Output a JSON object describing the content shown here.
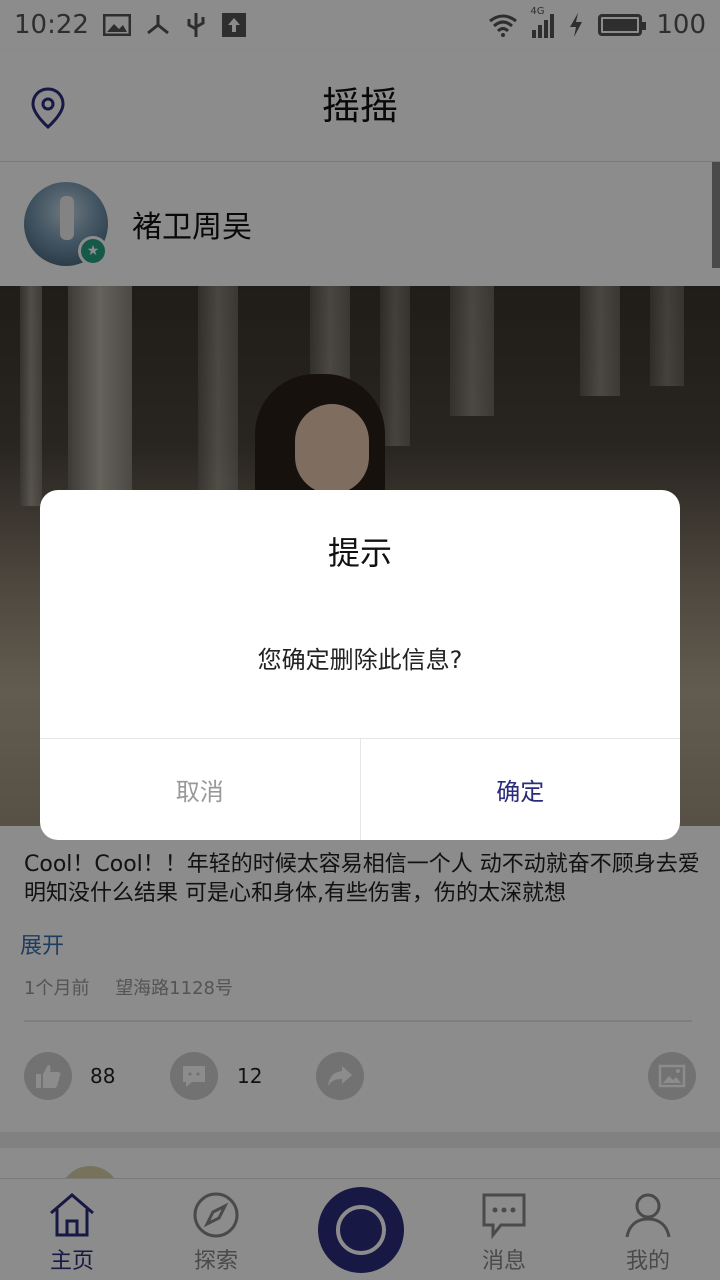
{
  "status_bar": {
    "time": "10:22",
    "network": "4G",
    "battery": "100",
    "battery_level": 1.0
  },
  "header": {
    "title": "摇摇",
    "location_icon": "location-pin-icon"
  },
  "post": {
    "username": "褚卫周吴",
    "text": "Cool！Cool！！年轻的时候太容易相信一个人 动不动就奋不顾身去爱 明知没什么结果 可是心和身体,有些伤害，伤的太深就想",
    "expand_label": "展开",
    "time_ago": "1个月前",
    "location": "望海路1128号",
    "like_count": "88",
    "comment_count": "12"
  },
  "bottom_nav": {
    "items": [
      {
        "label": "主页",
        "icon": "home-icon"
      },
      {
        "label": "探索",
        "icon": "compass-icon"
      },
      {
        "label": "消息",
        "icon": "message-icon"
      },
      {
        "label": "我的",
        "icon": "profile-icon"
      }
    ],
    "active": "主页",
    "center_icon": "shake-circle-icon"
  },
  "dialog": {
    "title": "提示",
    "message": "您确定删除此信息?",
    "cancel_label": "取消",
    "confirm_label": "确定"
  },
  "colors": {
    "accent": "#2b2c7a",
    "badge": "#2aa384",
    "link": "#3a6fb0"
  }
}
